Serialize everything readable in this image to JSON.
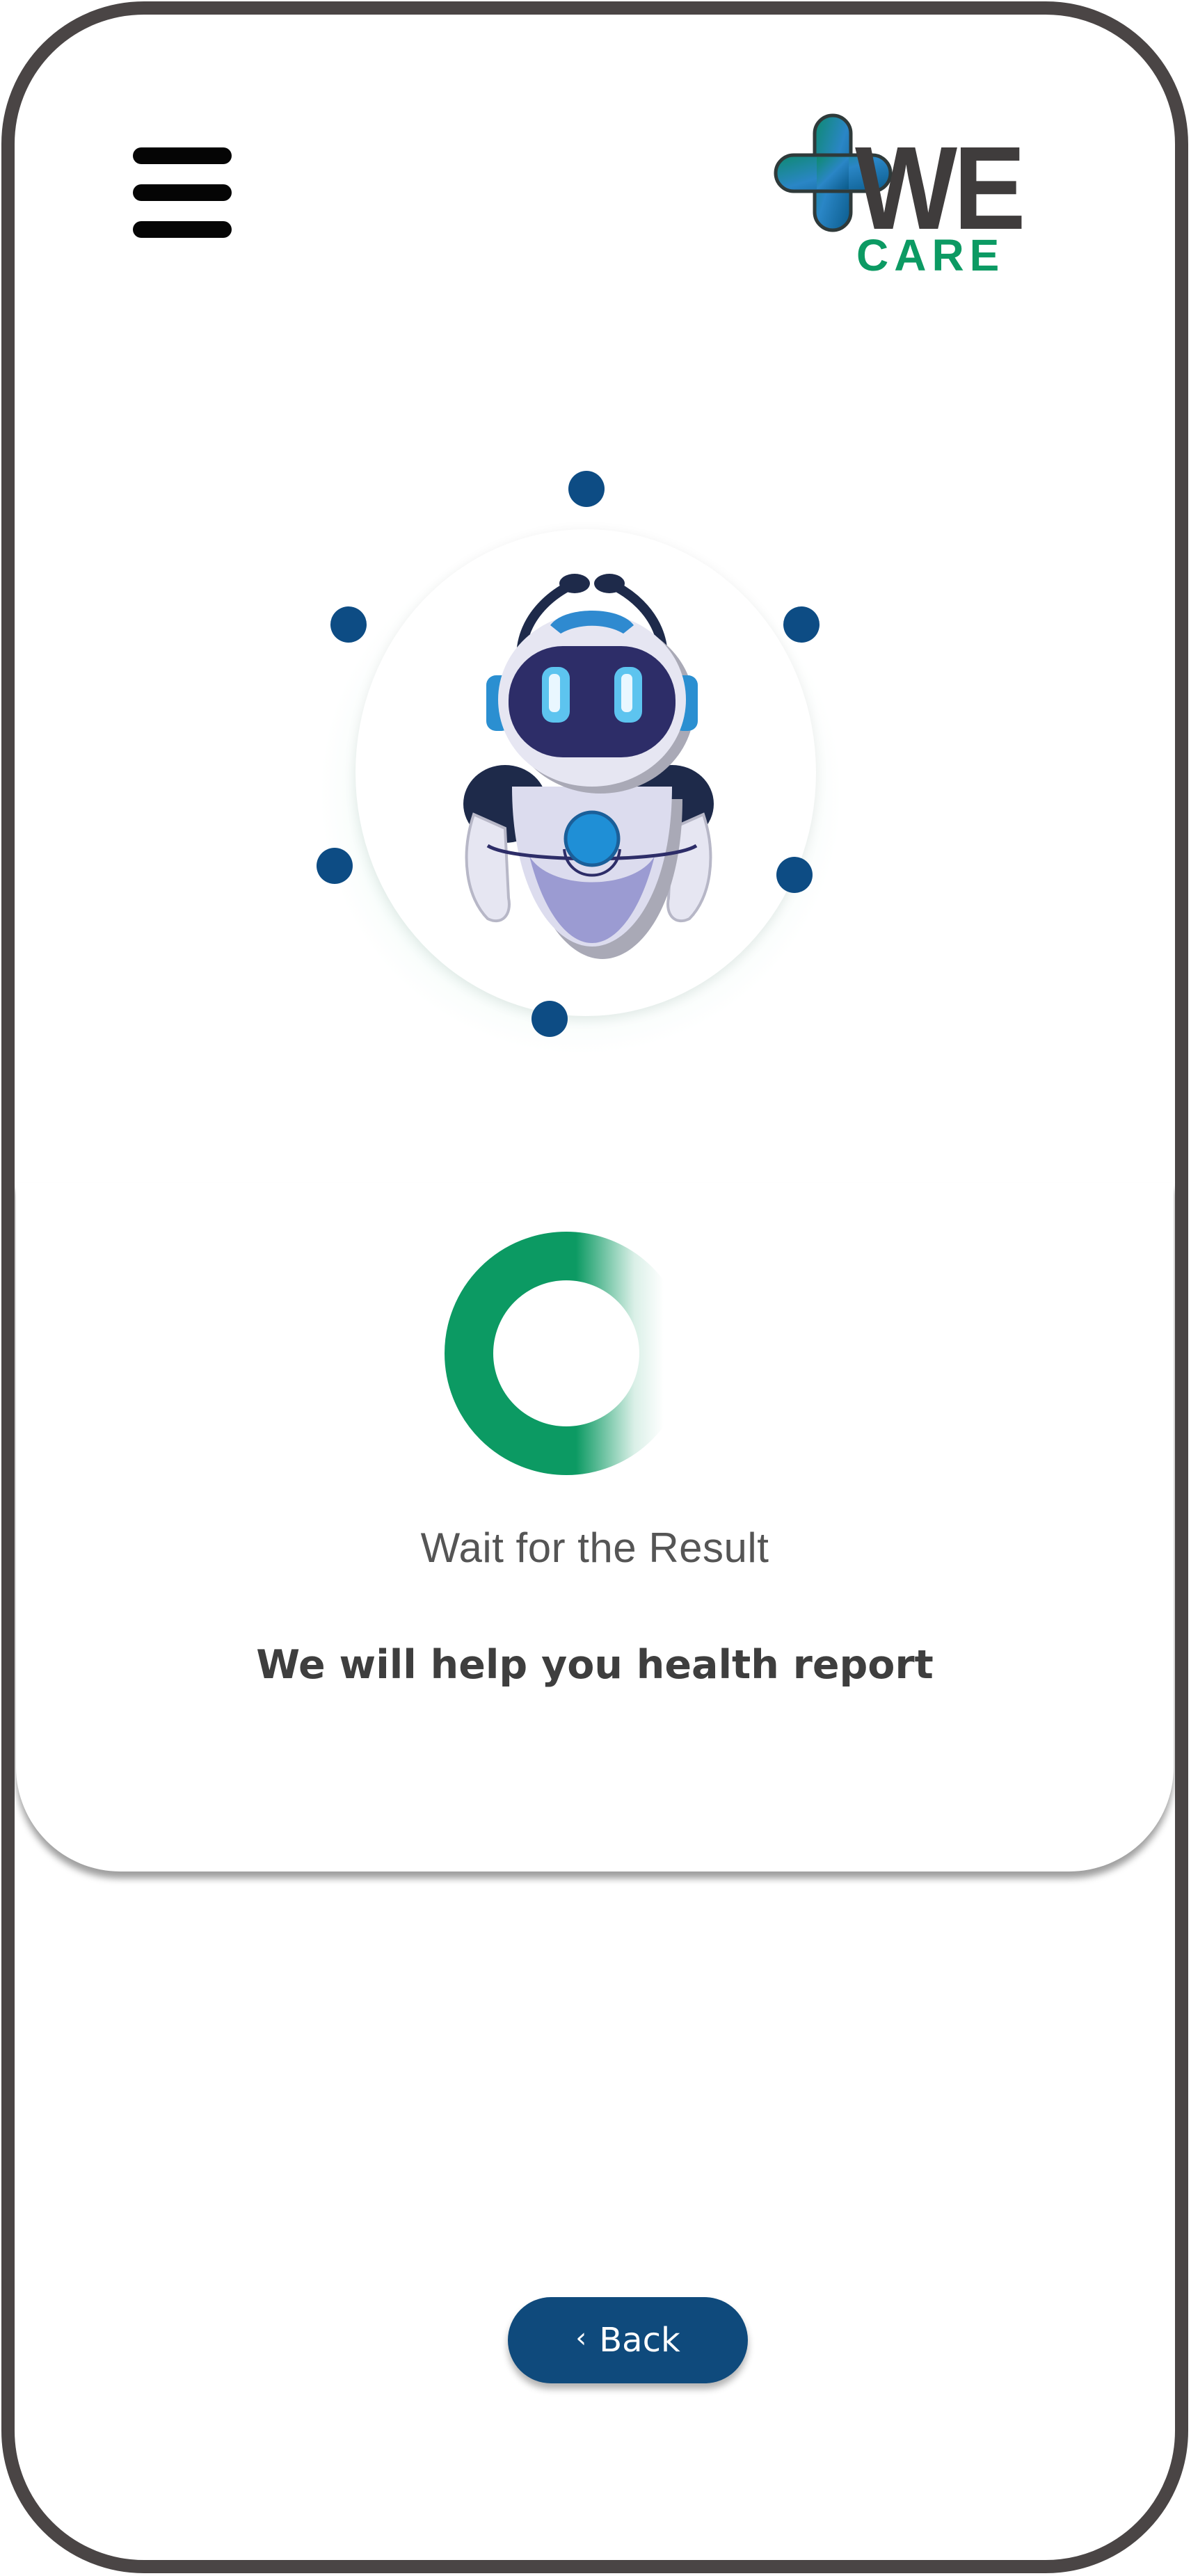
{
  "header": {
    "menu_icon": "hamburger-menu-icon",
    "logo": {
      "brand_top": "WE",
      "brand_bottom": "CARE",
      "icon": "medical-cross-icon",
      "colors": {
        "cross": "#0e6a88",
        "we": "#3f3c3c",
        "care": "#0c9a63"
      }
    }
  },
  "hero": {
    "icon": "robot-assistant-icon",
    "glow_color": "#62c8a4",
    "dot_color": "#0d4c84"
  },
  "status": {
    "spinner_icon": "loading-spinner-icon",
    "spinner_color": "#0c9a63",
    "title": "Wait for the Result",
    "subtitle": "We will help you health report"
  },
  "footer": {
    "back_label": "Back",
    "back_icon": "chevron-left-icon",
    "back_color": "#0f4a7c"
  }
}
